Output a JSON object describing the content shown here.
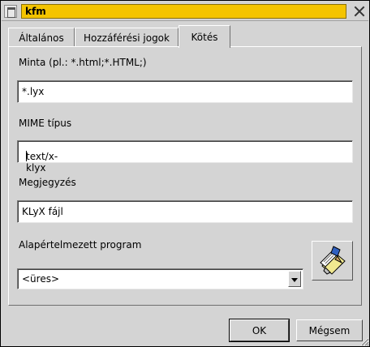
{
  "window": {
    "title": "kfm"
  },
  "tabs": [
    {
      "label": "Általános",
      "active": false
    },
    {
      "label": "Hozzáférési jogok",
      "active": false
    },
    {
      "label": "Kötés",
      "active": true
    }
  ],
  "form": {
    "pattern_label": "Minta (pl.: *.html;*.HTML;)",
    "pattern_value": "*.lyx",
    "mime_label": "MIME típus",
    "mime_value": "text/x-klyx",
    "comment_label": "Megjegyzés",
    "comment_value": "KLyX fájl",
    "program_label": "Alapértelmezett program",
    "program_value": "<üres>",
    "program_button_icon": "edit-file-icon"
  },
  "buttons": {
    "ok": "OK",
    "cancel": "Mégsem"
  },
  "colors": {
    "titlebar_active": "#f4c400",
    "dialog_bg": "#d4d4d4"
  }
}
